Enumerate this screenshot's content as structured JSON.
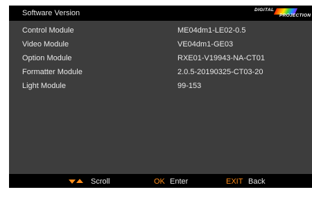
{
  "header": {
    "title": "Software Version",
    "logo": {
      "line1": "DIGITAL",
      "line2": "PROJECTION"
    }
  },
  "modules": [
    {
      "label": "Control Module",
      "value": "ME04dm1-LE02-0.5"
    },
    {
      "label": "Video Module",
      "value": "VE04dm1-GE03"
    },
    {
      "label": "Option Module",
      "value": "RXE01-V19943-NA-CT01"
    },
    {
      "label": "Formatter Module",
      "value": "2.0.5-20190325-CT03-20"
    },
    {
      "label": "Light Module",
      "value": "99-153"
    }
  ],
  "footer": {
    "scroll_label": "Scroll",
    "ok_key": "OK",
    "ok_label": "Enter",
    "exit_key": "EXIT",
    "exit_label": "Back"
  },
  "colors": {
    "accent": "#ff8c1a",
    "panel": "#3d3d3d",
    "bar": "#000000"
  }
}
